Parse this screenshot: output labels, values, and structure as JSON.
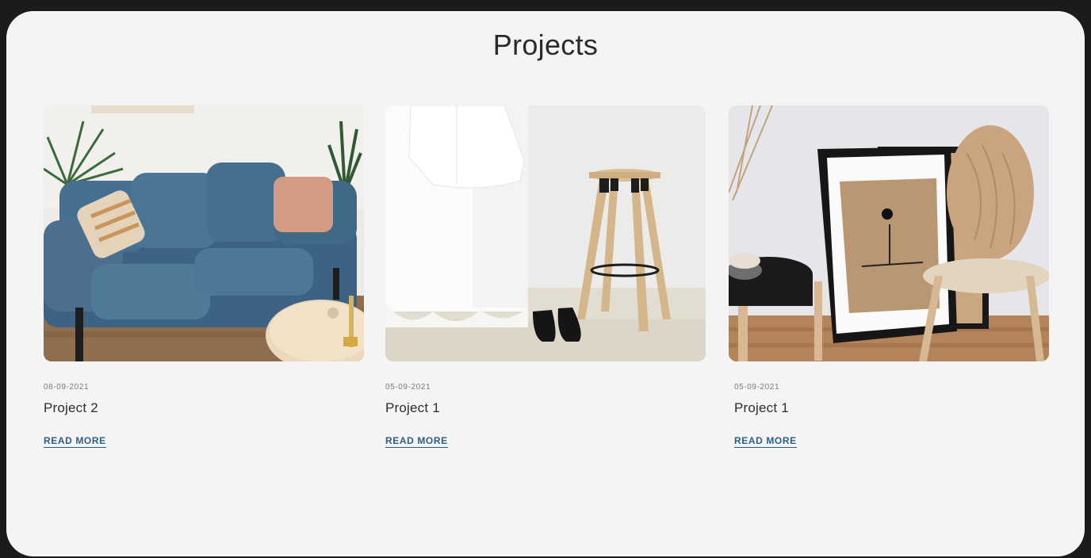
{
  "page": {
    "title": "Projects"
  },
  "projects": [
    {
      "date": "08-09-2021",
      "title": "Project 2",
      "link_label": "READ MORE",
      "image": "living-room-blue-sofa"
    },
    {
      "date": "05-09-2021",
      "title": "Project 1",
      "link_label": "READ MORE",
      "image": "wooden-stool-and-shoes"
    },
    {
      "date": "05-09-2021",
      "title": "Project 1",
      "link_label": "READ MORE",
      "image": "framed-art-and-chair"
    }
  ],
  "colors": {
    "background": "#f4f4f4",
    "outer": "#1b1b1b",
    "link": "#2c5f86",
    "title": "#2b2b2b"
  }
}
